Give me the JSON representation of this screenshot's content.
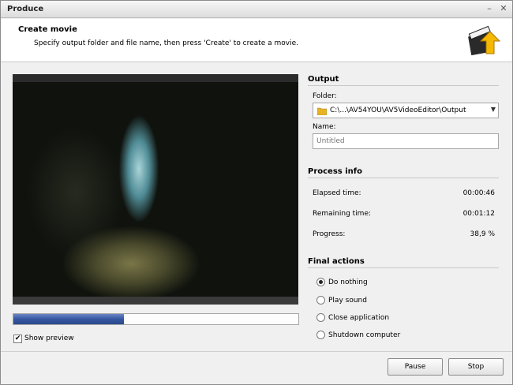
{
  "window": {
    "title": "Produce"
  },
  "header": {
    "title": "Create movie",
    "subtitle": "Specify output folder and file name, then press 'Create' to create a movie."
  },
  "preview": {
    "progress_fraction": 0.389,
    "show_preview_label": "Show preview",
    "show_preview_checked": true
  },
  "output": {
    "section_title": "Output",
    "folder_label": "Folder:",
    "folder_value": "C:\\...\\AV54YOU\\AV5VideoEditor\\Output",
    "name_label": "Name:",
    "name_placeholder": "Untitled"
  },
  "process_info": {
    "section_title": "Process info",
    "elapsed_label": "Elapsed time:",
    "elapsed_value": "00:00:46",
    "remaining_label": "Remaining time:",
    "remaining_value": "00:01:12",
    "progress_label": "Progress:",
    "progress_value": "38,9 %"
  },
  "final_actions": {
    "section_title": "Final actions",
    "options": [
      "Do nothing",
      "Play sound",
      "Close application",
      "Shutdown computer"
    ],
    "selected": "Do nothing"
  },
  "buttons": {
    "pause": "Pause",
    "stop": "Stop"
  },
  "icons": {
    "folder": "folder-icon",
    "logo": "movie-clapper-logo",
    "minimize": "minimize-icon",
    "close": "close-icon"
  }
}
